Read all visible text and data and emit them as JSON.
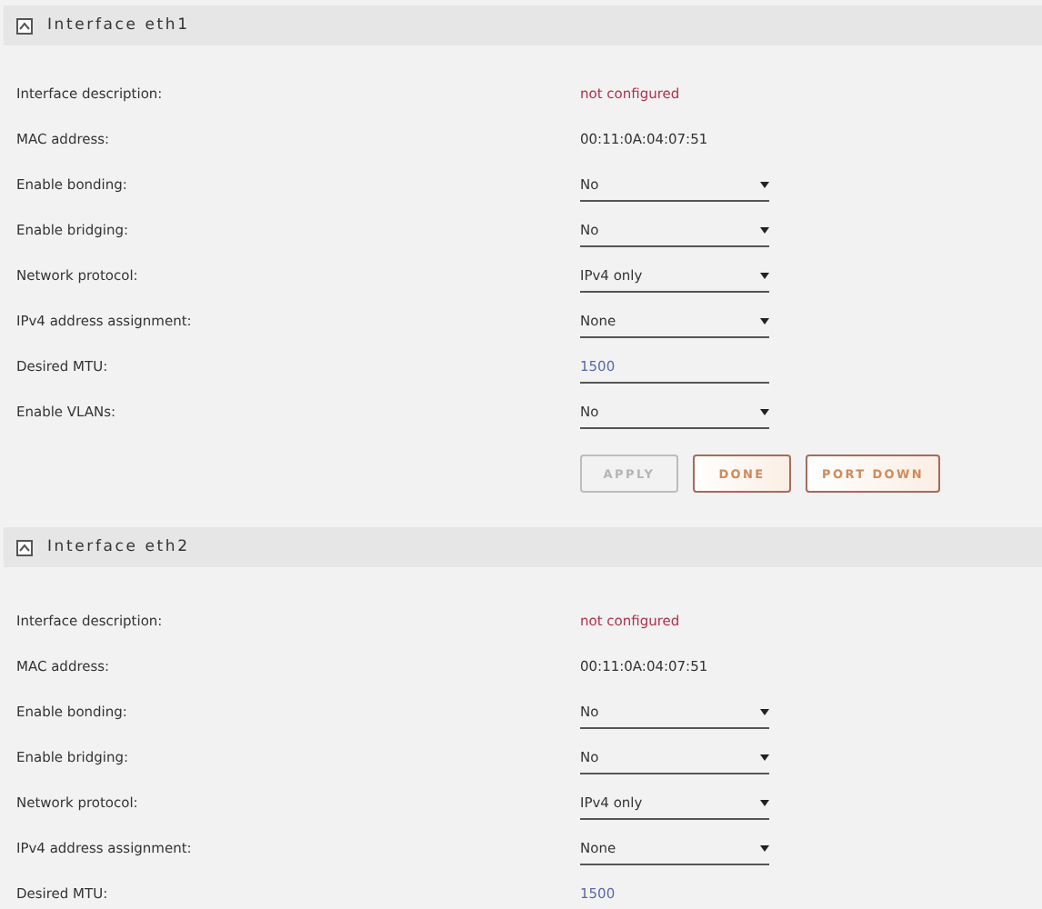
{
  "sections": [
    {
      "title": "Interface eth1",
      "expanded": true,
      "rows": [
        {
          "label": "Interface description:",
          "kind": "note",
          "value": "not configured"
        },
        {
          "label": "MAC address:",
          "kind": "text",
          "value": "00:11:0A:04:07:51"
        },
        {
          "label": "Enable bonding:",
          "kind": "select",
          "value": "No"
        },
        {
          "label": "Enable bridging:",
          "kind": "select",
          "value": "No"
        },
        {
          "label": "Network protocol:",
          "kind": "select",
          "value": "IPv4 only"
        },
        {
          "label": "IPv4 address assignment:",
          "kind": "select",
          "value": "None"
        },
        {
          "label": "Desired MTU:",
          "kind": "input",
          "value": "1500"
        },
        {
          "label": "Enable VLANs:",
          "kind": "select",
          "value": "No"
        }
      ],
      "buttons": [
        {
          "label": "APPLY",
          "disabled": true
        },
        {
          "label": "DONE",
          "disabled": false
        },
        {
          "label": "PORT DOWN",
          "disabled": false
        }
      ]
    },
    {
      "title": "Interface eth2",
      "expanded": true,
      "rows": [
        {
          "label": "Interface description:",
          "kind": "note",
          "value": "not configured"
        },
        {
          "label": "MAC address:",
          "kind": "text",
          "value": "00:11:0A:04:07:51"
        },
        {
          "label": "Enable bonding:",
          "kind": "select",
          "value": "No"
        },
        {
          "label": "Enable bridging:",
          "kind": "select",
          "value": "No"
        },
        {
          "label": "Network protocol:",
          "kind": "select",
          "value": "IPv4 only"
        },
        {
          "label": "IPv4 address assignment:",
          "kind": "select",
          "value": "None"
        },
        {
          "label": "Desired MTU:",
          "kind": "input",
          "value": "1500"
        }
      ]
    }
  ]
}
